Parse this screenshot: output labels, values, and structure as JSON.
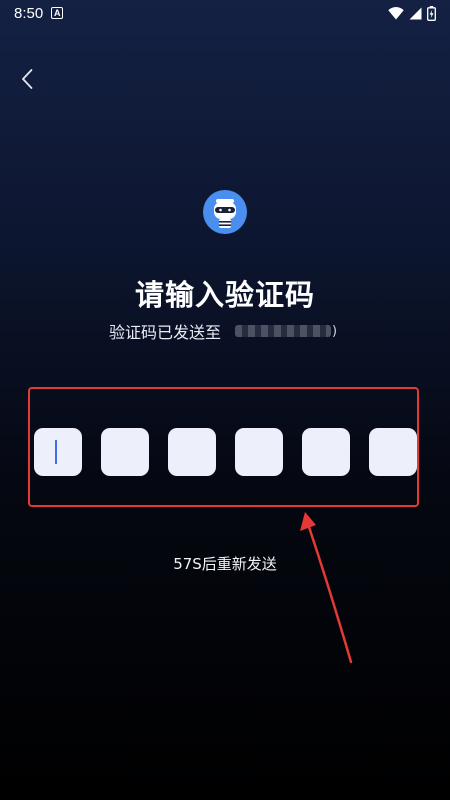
{
  "status_bar": {
    "time": "8:50",
    "notification_icon_letter": "A",
    "icons": [
      "wifi-icon",
      "cell-signal-icon",
      "battery-charging-icon"
    ]
  },
  "nav": {
    "back_icon": "chevron-left-icon"
  },
  "app_logo_icon": "masked-robot-avatar-icon",
  "title": "请输入验证码",
  "subtitle": {
    "label": "验证码已发送至",
    "phone": "",
    "suffix": ")"
  },
  "code_input": {
    "length": 6,
    "digits": [
      "",
      "",
      "",
      "",
      "",
      ""
    ],
    "active_index": 0
  },
  "resend": {
    "text": "57S后重新发送",
    "seconds_remaining": 57
  },
  "annotation": {
    "box_color": "#e53935",
    "arrow_color": "#e53935"
  },
  "colors": {
    "code_box_bg": "#edf0fb",
    "caret": "#3f6ee6",
    "logo_bg": "#4a8ff0"
  }
}
